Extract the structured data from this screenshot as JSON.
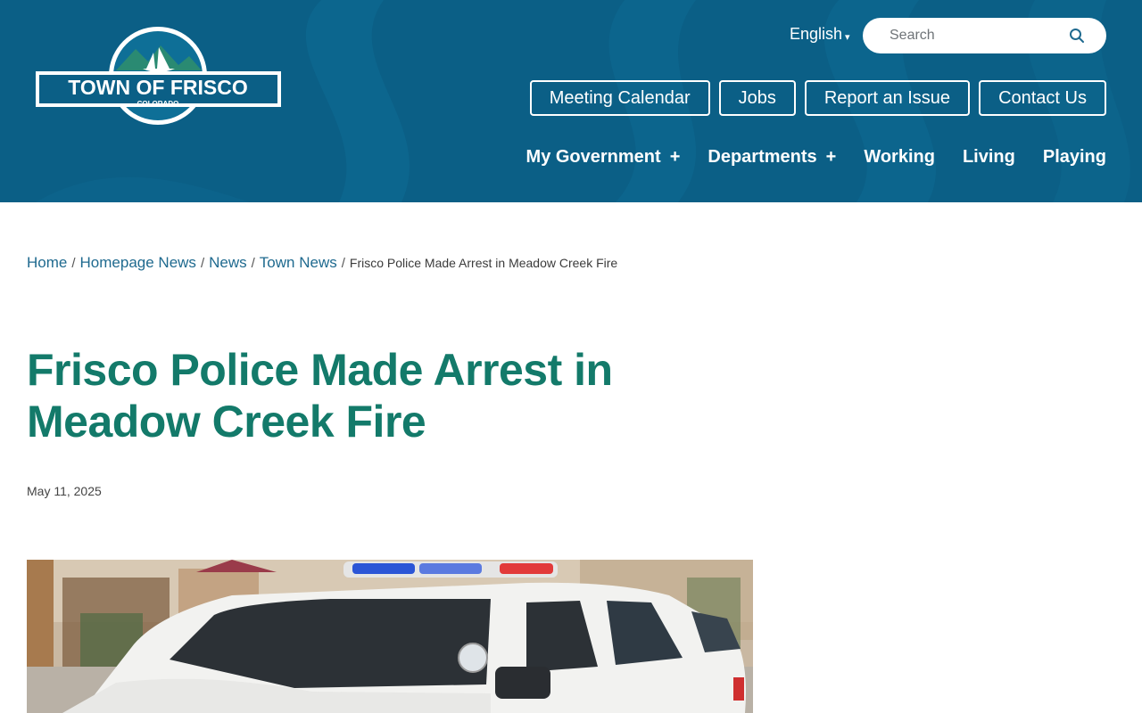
{
  "header": {
    "logo": {
      "title": "TOWN OF FRISCO",
      "subtitle": "COLORADO"
    },
    "language": {
      "selected": "English",
      "caret": "▾"
    },
    "search": {
      "placeholder": "Search",
      "icon": "search-icon"
    },
    "quick_links": [
      {
        "label": "Meeting Calendar"
      },
      {
        "label": "Jobs"
      },
      {
        "label": "Report an Issue"
      },
      {
        "label": "Contact Us"
      }
    ],
    "nav": [
      {
        "label": "My Government",
        "expand": "+"
      },
      {
        "label": "Departments",
        "expand": "+"
      },
      {
        "label": "Working"
      },
      {
        "label": "Living"
      },
      {
        "label": "Playing"
      }
    ],
    "colors": {
      "header_bg": "#0b5f86",
      "logo_green": "#2a8a72",
      "logo_sky": "#0e6f97"
    }
  },
  "breadcrumb": {
    "items": [
      "Home",
      "Homepage News",
      "News",
      "Town News"
    ],
    "separator": "/",
    "current": "Frisco Police Made Arrest in Meadow Creek Fire"
  },
  "article": {
    "title": "Frisco Police Made Arrest in Meadow Creek Fire",
    "date": "May 11, 2025",
    "title_color": "#137a6a"
  }
}
